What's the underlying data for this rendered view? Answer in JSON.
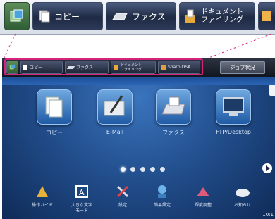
{
  "callout_tabs": [
    {
      "label": "コピー"
    },
    {
      "label": "ファクス"
    },
    {
      "label": "ドキュメント\nファイリング"
    }
  ],
  "top_tabs": [
    {
      "label": "コピー"
    },
    {
      "label": "ファクス"
    },
    {
      "label": "ドキュメント\nファイリング"
    },
    {
      "label": "Sharp OSA"
    }
  ],
  "job_status_label": "ジョブ状況",
  "apps": [
    {
      "name": "コピー",
      "icon": "copy-icon"
    },
    {
      "name": "E-Mail",
      "icon": "email-icon"
    },
    {
      "name": "ファクス",
      "icon": "fax-icon"
    },
    {
      "name": "FTP/Desktop",
      "icon": "ftp-desktop-icon"
    }
  ],
  "page_indicator": {
    "count": 5,
    "active": 1
  },
  "shortcuts": [
    {
      "label": "操作ガイド",
      "icon": "guide-icon"
    },
    {
      "label": "大きな文字\nモード",
      "icon": "large-text-icon"
    },
    {
      "label": "設定",
      "icon": "settings-icon"
    },
    {
      "label": "簡易設定",
      "icon": "easy-settings-icon"
    },
    {
      "label": "輝度調整",
      "icon": "brightness-icon"
    },
    {
      "label": "お知らせ",
      "icon": "news-icon"
    }
  ],
  "clock": "10:1",
  "colors": {
    "highlight": "#d6237e",
    "screen_bg": "#23508f",
    "tab_bg": "#1e2a44"
  }
}
